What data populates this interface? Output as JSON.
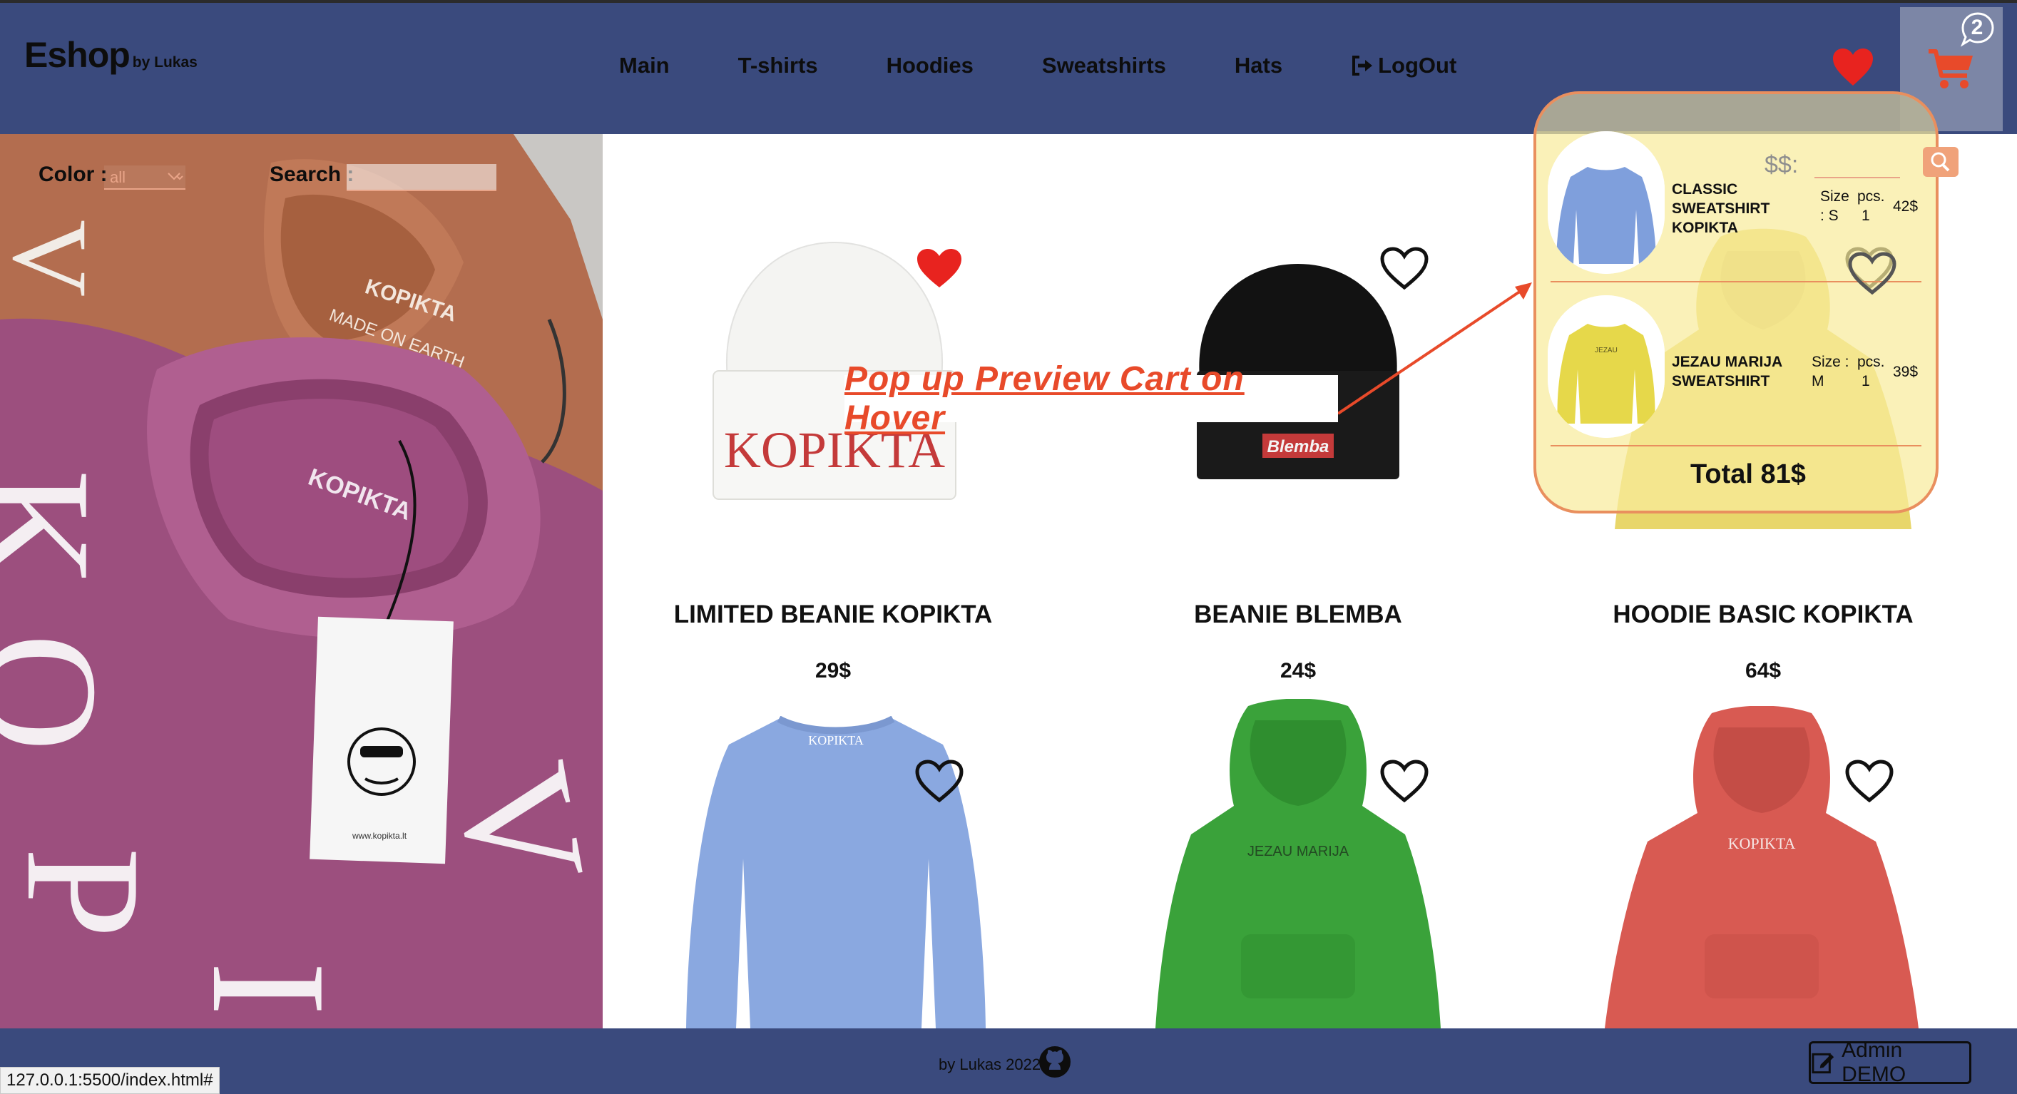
{
  "brand": {
    "name": "Eshop",
    "by": "by Lukas"
  },
  "nav": [
    "Main",
    "T-shirts",
    "Hoodies",
    "Sweatshirts",
    "Hats",
    "LogOut"
  ],
  "cart": {
    "count": "2"
  },
  "filters": {
    "color_label": "Color :",
    "color_value": "all",
    "search_label": "Search :",
    "search_placeholder": ""
  },
  "hero": {
    "tag_brand": "KOPIKTA",
    "tag_line": "MADE ON EARTH",
    "big_letters": "KOPIKTA",
    "tag_url": "www.kopikta.lt"
  },
  "annotation": "Pop up Preview Cart on Hover",
  "products": [
    {
      "title": "LIMITED BEANIE KOPIKTA",
      "price": "29$",
      "print": "KOPIKTA",
      "color": "#f4f4f2",
      "favorited": true
    },
    {
      "title": "BEANIE BLEMBA",
      "price": "24$",
      "print": "Blemba",
      "color": "#111111",
      "favorited": false
    },
    {
      "title": "HOODIE BASIC KOPIKTA",
      "price": "64$",
      "color": "#e8d66a",
      "favorited": false
    },
    {
      "title": "",
      "price": "",
      "print": "KOPIKTA",
      "color": "#8aa8e0",
      "favorited": false
    },
    {
      "title": "",
      "price": "",
      "print": "JEZAU MARIJA",
      "color": "#3aa23a",
      "favorited": false
    },
    {
      "title": "",
      "price": "",
      "print": "KOPIKTA",
      "color": "#d85a52",
      "favorited": false
    }
  ],
  "cart_popup": {
    "currency_label": "$$:",
    "items": [
      {
        "name_lines": [
          "CLASSIC",
          "SWEATSHIRT",
          "KOPIKTA"
        ],
        "size_label": "Size",
        "size_value": ": S",
        "pcs_label": "pcs.",
        "pcs_value": "1",
        "price": "42$",
        "color": "#7f9fdc"
      },
      {
        "name_lines": [
          "JEZAU MARIJA",
          "SWEATSHIRT"
        ],
        "size_label": "Size :",
        "size_value": "M",
        "pcs_label": "pcs.",
        "pcs_value": "1",
        "price": "39$",
        "color": "#e6d84a"
      }
    ],
    "total": "Total 81$"
  },
  "footer": {
    "credit": "by Lukas 2022",
    "admin_label": "Admin DEMO"
  },
  "status_url": "127.0.0.1:5500/index.html#",
  "colors": {
    "header": "#3a4a7d",
    "accent": "#e84a2a",
    "heart": "#e8231f",
    "popup_border": "#e98f5e"
  },
  "icons": [
    "logout-icon",
    "heart-icon",
    "cart-icon",
    "chevron-down-icon",
    "search-icon",
    "github-icon",
    "edit-icon"
  ]
}
